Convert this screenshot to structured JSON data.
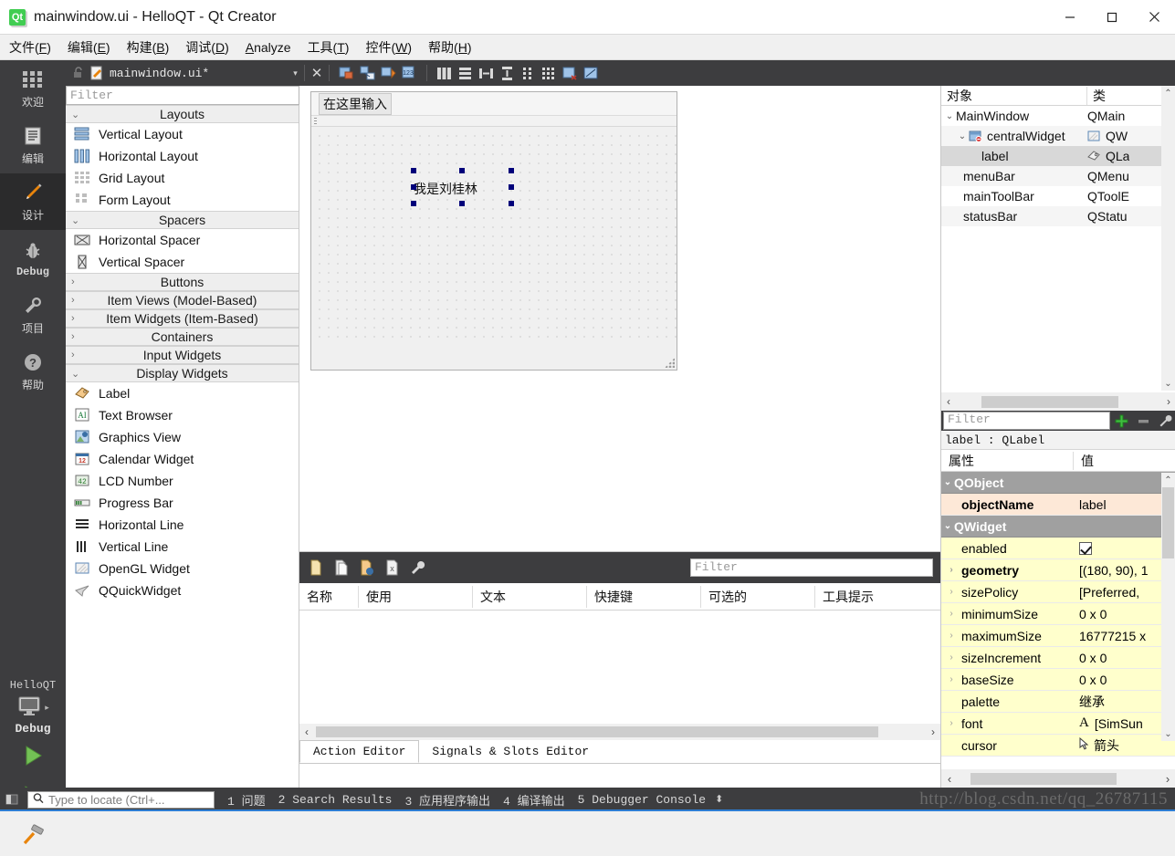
{
  "window": {
    "title": "mainwindow.ui - HelloQT - Qt Creator",
    "app_icon": "qt-logo-icon",
    "minimize": "minimize-icon",
    "maximize": "maximize-icon",
    "close": "close-icon"
  },
  "menubar": [
    {
      "label": "文件(",
      "mnemonic": "F",
      "tail": ")"
    },
    {
      "label": "编辑(",
      "mnemonic": "E",
      "tail": ")"
    },
    {
      "label": "构建(",
      "mnemonic": "B",
      "tail": ")"
    },
    {
      "label": "调试(",
      "mnemonic": "D",
      "tail": ")"
    },
    {
      "label": "",
      "mnemonic": "A",
      "tail": "nalyze"
    },
    {
      "label": "工具(",
      "mnemonic": "T",
      "tail": ")"
    },
    {
      "label": "控件(",
      "mnemonic": "W",
      "tail": ")"
    },
    {
      "label": "帮助(",
      "mnemonic": "H",
      "tail": ")"
    }
  ],
  "editor_toolbar": {
    "lock_icon": "unlocked-icon",
    "file_icon": "ui-file-icon",
    "filename": "mainwindow.ui*",
    "dropdown_arrow": "▾",
    "close_label": "✕",
    "tools": [
      "edit-widgets-icon",
      "edit-signals-slots-icon",
      "edit-buddies-icon",
      "edit-tab-order-icon",
      "layout-horizontally-icon",
      "layout-vertically-icon",
      "layout-in-splitter-h-icon",
      "layout-in-splitter-v-icon",
      "layout-form-icon",
      "layout-grid-icon",
      "break-layout-icon",
      "adjust-size-icon"
    ]
  },
  "modebar": {
    "modes": [
      {
        "label": "欢迎",
        "icon": "welcome-icon",
        "latin": false,
        "active": false
      },
      {
        "label": "编辑",
        "icon": "edit-icon",
        "latin": false,
        "active": false
      },
      {
        "label": "设计",
        "icon": "design-pencil-icon",
        "latin": false,
        "active": true
      },
      {
        "label": "Debug",
        "icon": "debug-bug-icon",
        "latin": true,
        "active": false
      },
      {
        "label": "项目",
        "icon": "projects-wrench-icon",
        "latin": false,
        "active": false
      },
      {
        "label": "帮助",
        "icon": "help-question-icon",
        "latin": false,
        "active": false
      }
    ],
    "kit_name": "HelloQT",
    "kit_icon": "desktop-target-icon",
    "kit_arrow": "▸",
    "build_config": "Debug",
    "run_button": "run-icon",
    "debug_button": "debug-run-icon",
    "build_button": "build-hammer-icon"
  },
  "widgetbox": {
    "filter_placeholder": "Filter",
    "groups": [
      {
        "title": "Layouts",
        "expanded": true,
        "chevron": "⌄",
        "items": [
          {
            "label": "Vertical Layout",
            "icon": "vertical-layout-icon"
          },
          {
            "label": "Horizontal Layout",
            "icon": "horizontal-layout-icon"
          },
          {
            "label": "Grid Layout",
            "icon": "grid-layout-icon"
          },
          {
            "label": "Form Layout",
            "icon": "form-layout-icon"
          }
        ]
      },
      {
        "title": "Spacers",
        "expanded": true,
        "chevron": "⌄",
        "items": [
          {
            "label": "Horizontal Spacer",
            "icon": "horizontal-spacer-icon"
          },
          {
            "label": "Vertical Spacer",
            "icon": "vertical-spacer-icon"
          }
        ]
      },
      {
        "title": "Buttons",
        "expanded": false,
        "chevron": "›",
        "items": []
      },
      {
        "title": "Item Views (Model-Based)",
        "expanded": false,
        "chevron": "›",
        "items": []
      },
      {
        "title": "Item Widgets (Item-Based)",
        "expanded": false,
        "chevron": "›",
        "items": []
      },
      {
        "title": "Containers",
        "expanded": false,
        "chevron": "›",
        "items": []
      },
      {
        "title": "Input Widgets",
        "expanded": false,
        "chevron": "›",
        "items": []
      },
      {
        "title": "Display Widgets",
        "expanded": true,
        "chevron": "⌄",
        "items": [
          {
            "label": "Label",
            "icon": "label-tag-icon"
          },
          {
            "label": "Text Browser",
            "icon": "text-browser-icon"
          },
          {
            "label": "Graphics View",
            "icon": "graphics-view-icon"
          },
          {
            "label": "Calendar Widget",
            "icon": "calendar-icon"
          },
          {
            "label": "LCD Number",
            "icon": "lcd-number-icon"
          },
          {
            "label": "Progress Bar",
            "icon": "progress-bar-icon"
          },
          {
            "label": "Horizontal Line",
            "icon": "horizontal-line-icon"
          },
          {
            "label": "Vertical Line",
            "icon": "vertical-line-icon"
          },
          {
            "label": "OpenGL Widget",
            "icon": "opengl-widget-icon"
          },
          {
            "label": "QQuickWidget",
            "icon": "qquickwidget-icon"
          }
        ]
      }
    ]
  },
  "form": {
    "menubar_placeholder": "在这里输入",
    "selected_widget_text": "我是刘桂林",
    "size_grip": "size-grip-icon"
  },
  "action_editor": {
    "toolbar_icons": [
      "new-action-icon",
      "copy-action-icon",
      "edit-action-icon",
      "delete-action-icon",
      "configure-icon"
    ],
    "filter_placeholder": "Filter",
    "columns": [
      "名称",
      "使用",
      "文本",
      "快捷键",
      "可选的",
      "工具提示"
    ],
    "rows": [],
    "tabs": [
      {
        "label": "Action Editor",
        "active": true
      },
      {
        "label": "Signals & Slots Editor",
        "active": false
      }
    ],
    "scroll_left": "‹",
    "scroll_right": "›"
  },
  "object_tree": {
    "columns": [
      "对象",
      "类"
    ],
    "rows": [
      {
        "name": "MainWindow",
        "cls": "QMain",
        "indent": 0,
        "chevron": "⌄",
        "icon": "",
        "selected": false
      },
      {
        "name": "centralWidget",
        "cls": "QW",
        "indent": 1,
        "chevron": "⌄",
        "icon": "central-widget-icon",
        "selected": false
      },
      {
        "name": "label",
        "cls": "QLa",
        "indent": 2,
        "chevron": "",
        "icon": "label-tag-icon",
        "selected": true
      },
      {
        "name": "menuBar",
        "cls": "QMenu",
        "indent": 1,
        "chevron": "",
        "icon": "",
        "selected": false
      },
      {
        "name": "mainToolBar",
        "cls": "QToolE",
        "indent": 1,
        "chevron": "",
        "icon": "",
        "selected": false
      },
      {
        "name": "statusBar",
        "cls": "QStatu",
        "indent": 1,
        "chevron": "",
        "icon": "",
        "selected": false
      }
    ],
    "scroll_left": "‹",
    "scroll_right": "›",
    "scroll_up": "⌃",
    "scroll_down": "⌄"
  },
  "property_editor": {
    "filter_placeholder": "Filter",
    "add_button": "add-icon",
    "remove_button": "remove-icon",
    "configure_button": "configure-icon",
    "object_header": "label : QLabel",
    "columns": [
      "属性",
      "值"
    ],
    "rows": [
      {
        "kind": "group",
        "name": "QObject",
        "value": "",
        "chevron": "⌄"
      },
      {
        "kind": "objname",
        "name": "objectName",
        "value": "label",
        "expand": ""
      },
      {
        "kind": "group",
        "name": "QWidget",
        "value": "",
        "chevron": "⌄"
      },
      {
        "kind": "prop",
        "name": "enabled",
        "value": "",
        "expand": "",
        "control": "checkbox",
        "checked": true
      },
      {
        "kind": "prop",
        "name": "geometry",
        "value": "[(180, 90), 1",
        "expand": "›",
        "bold": true
      },
      {
        "kind": "prop",
        "name": "sizePolicy",
        "value": "[Preferred,",
        "expand": "›"
      },
      {
        "kind": "prop",
        "name": "minimumSize",
        "value": "0 x 0",
        "expand": "›"
      },
      {
        "kind": "prop",
        "name": "maximumSize",
        "value": "16777215 x",
        "expand": "›"
      },
      {
        "kind": "prop",
        "name": "sizeIncrement",
        "value": "0 x 0",
        "expand": "›"
      },
      {
        "kind": "prop",
        "name": "baseSize",
        "value": "0 x 0",
        "expand": "›"
      },
      {
        "kind": "prop",
        "name": "palette",
        "value": "继承",
        "expand": ""
      },
      {
        "kind": "prop",
        "name": "font",
        "value": "[SimSun",
        "expand": "›",
        "icon": "font-A-icon"
      },
      {
        "kind": "prop",
        "name": "cursor",
        "value": "箭头",
        "expand": "",
        "icon": "cursor-arrow-icon"
      }
    ],
    "scroll_up": "⌃",
    "scroll_down": "⌄",
    "scroll_left": "‹",
    "scroll_right": "›"
  },
  "statusbar": {
    "sidebar_toggle": "sidebar-toggle-icon",
    "locator_icon": "search-icon",
    "locator_placeholder": "Type to locate (Ctrl+...",
    "panes": [
      "1 问题",
      "2 Search Results",
      "3 应用程序输出",
      "4 编译输出",
      "5 Debugger Console"
    ],
    "updown": "⬍",
    "watermark": "http://blog.csdn.net/qq_26787115"
  }
}
